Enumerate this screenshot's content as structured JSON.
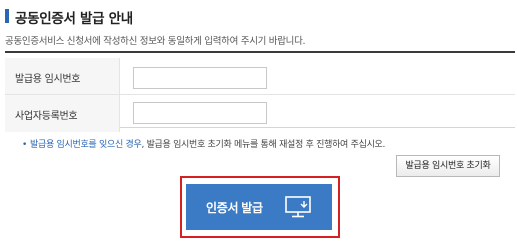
{
  "header": {
    "title": "공동인증서 발급 안내",
    "description": "공동인증서비스 신청서에 작성하신 정보와 동일하게 입력하여 주시기 바랍니다."
  },
  "form": {
    "rows": [
      {
        "label": "발급용 임시번호",
        "value": "",
        "placeholder": ""
      },
      {
        "label": "사업자등록번호",
        "value": "",
        "placeholder": ""
      }
    ]
  },
  "note": {
    "bullet": "•",
    "link_text": "발급용 임시번호를 잊으신 경우",
    "rest_text": ", 발급용 임시번호 초기화 메뉴를 통해 재설정 후 진행하여 주십시오."
  },
  "buttons": {
    "reset_label": "발급용 임시번호 초기화",
    "issue_label": "인증서 발급",
    "issue_icon": "monitor-icon"
  },
  "colors": {
    "accent": "#3b7bc5",
    "highlight": "#d42020",
    "link": "#2a66b4"
  }
}
